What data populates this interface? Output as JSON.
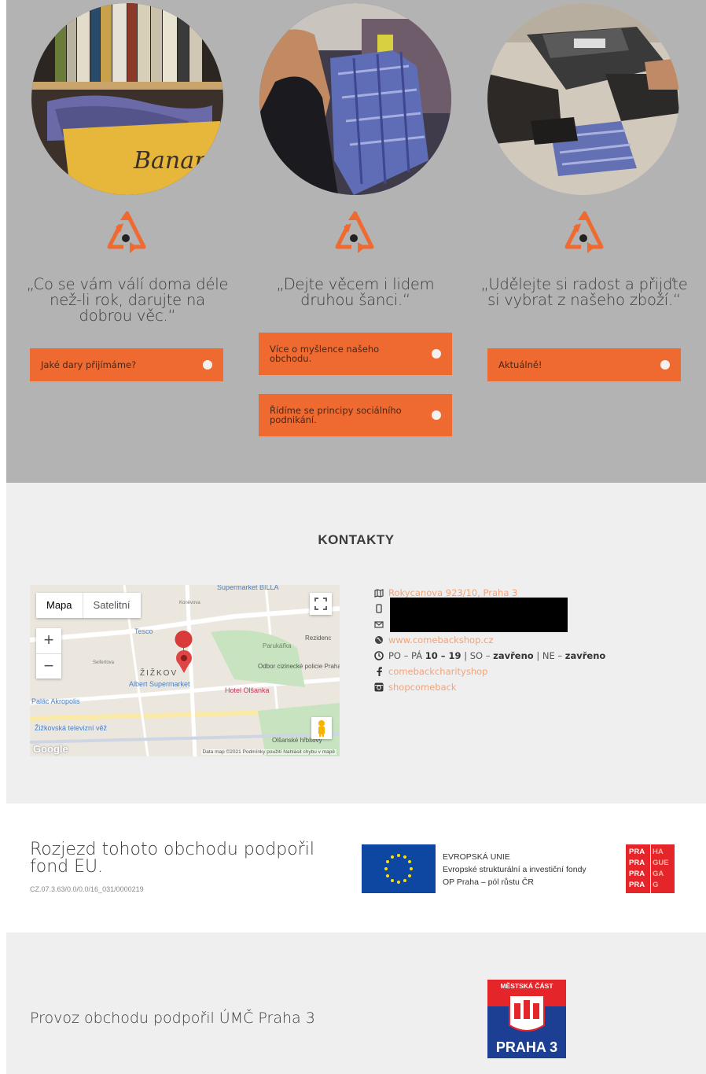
{
  "steps": [
    {
      "quote": "„Co se vám válí doma déle než-li rok, darujte na dobrou věc.“",
      "buttons": [
        "Jaké dary přijímáme?"
      ],
      "icon": "recycle-icon-1"
    },
    {
      "quote": "„Dejte věcem i lidem druhou šanci.“",
      "buttons": [
        "Více o myšlence našeho obchodu.",
        "Řídíme se principy sociálního podnikání."
      ],
      "icon": "recycle-icon-2"
    },
    {
      "quote": "„Udělejte si radost a přijďte si vybrat z našeho zboží.“",
      "buttons": [
        "Aktuálně!"
      ],
      "icon": "recycle-icon-3"
    }
  ],
  "contacts": {
    "title": "KONTAKTY",
    "map": {
      "tab_map": "Mapa",
      "tab_satellite": "Satelitní",
      "zoom_in": "+",
      "zoom_out": "−",
      "labels": [
        "Supermarket BILLA",
        "Tesco",
        "Parukářka",
        "Rezidenc",
        "ŽIŽKOV",
        "Albert Supermarket",
        "Hotel Olšanka",
        "Odbor cizinecké policie Praha",
        "Palác Akropolis",
        "Žižkovská televizní věž",
        "Olšanské hřbitovy",
        "Koněvova",
        "Seifertova"
      ],
      "footer": "Data map ©2021   Podmínky použití   Nahlásit chybu v mapě",
      "logo": "Google"
    },
    "address": "Rokycanova 923/10, Praha 3",
    "web": "www.comebackshop.cz",
    "hours": {
      "prefix": "PO – PÁ",
      "weekday": "10 – 19",
      "sat_label": "SO –",
      "sat": "zavřeno",
      "sun_label": "NE –",
      "sun": "zavřeno"
    },
    "facebook": "comebackcharityshop",
    "instagram": "shopcomeback"
  },
  "eu": {
    "title": "Rozjezd tohoto obchodu podpořil fond EU.",
    "code": "CZ.07.3.63/0.0/0.0/16_031/0000219",
    "line1": "EVROPSKÁ UNIE",
    "line2": "Evropské strukturální a investiční fondy",
    "line3": "OP Praha – pól růstu ČR",
    "praha_logo": [
      "PRA",
      "HA",
      "PRA",
      "GUE",
      "PRA",
      "GA",
      "PRA",
      "G"
    ]
  },
  "praha3": {
    "text": "Provoz obchodu podpořil ÚMČ Praha 3",
    "logo_top": "MĚSTSKÁ ČÁST",
    "logo_bottom": "PRAHA 3"
  },
  "colors": {
    "accent": "#ef6a30",
    "link": "#f1a37a",
    "grey_band": "#b3b3b3",
    "light_band": "#efefef"
  }
}
